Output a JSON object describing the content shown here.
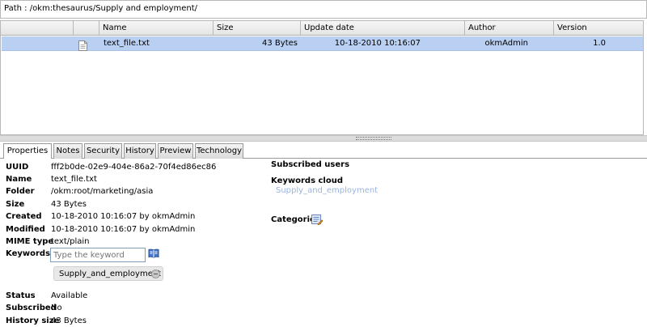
{
  "path": {
    "label": "Path : /okm:thesaurus/Supply and employment/"
  },
  "grid": {
    "columns": [
      "Name",
      "Size",
      "Update date",
      "Author",
      "Version"
    ],
    "rows": [
      {
        "icon": "text-file-icon",
        "name": "text_file.txt",
        "size": "43 Bytes",
        "update_date": "10-18-2010 10:16:07",
        "author": "okmAdmin",
        "version": "1.0"
      }
    ]
  },
  "tabs": [
    {
      "label": "Properties",
      "active": true
    },
    {
      "label": "Notes",
      "active": false
    },
    {
      "label": "Security",
      "active": false
    },
    {
      "label": "History",
      "active": false
    },
    {
      "label": "Preview",
      "active": false
    },
    {
      "label": "Technology",
      "active": false
    }
  ],
  "properties": {
    "uuid_label": "UUID",
    "uuid": "fff2b0de-02e9-404e-86a2-70f4ed86ec86",
    "name_label": "Name",
    "name": "text_file.txt",
    "folder_label": "Folder",
    "folder": "/okm:root/marketing/asia",
    "size_label": "Size",
    "size": "43 Bytes",
    "created_label": "Created",
    "created": "10-18-2010 10:16:07 by okmAdmin",
    "modified_label": "Modified",
    "modified": "10-18-2010 10:16:07 by okmAdmin",
    "mime_label": "MIME type",
    "mime": "text/plain",
    "keywords_label": "Keywords",
    "keyword_placeholder": "Type the keyword",
    "keyword_chip": "Supply_and_employment",
    "status_label": "Status",
    "status": "Available",
    "subscribed_label": "Subscribed",
    "subscribed": "No",
    "history_label": "History size",
    "history": "43 Bytes"
  },
  "right": {
    "subscribed_users_label": "Subscribed users",
    "keywords_cloud_label": "Keywords cloud",
    "cloud_words": [
      "Supply_and_employment"
    ],
    "categories_label": "Categories"
  },
  "colors": {
    "selected_row": "#bad0f2",
    "cloud_word": "#9ab4e0"
  }
}
